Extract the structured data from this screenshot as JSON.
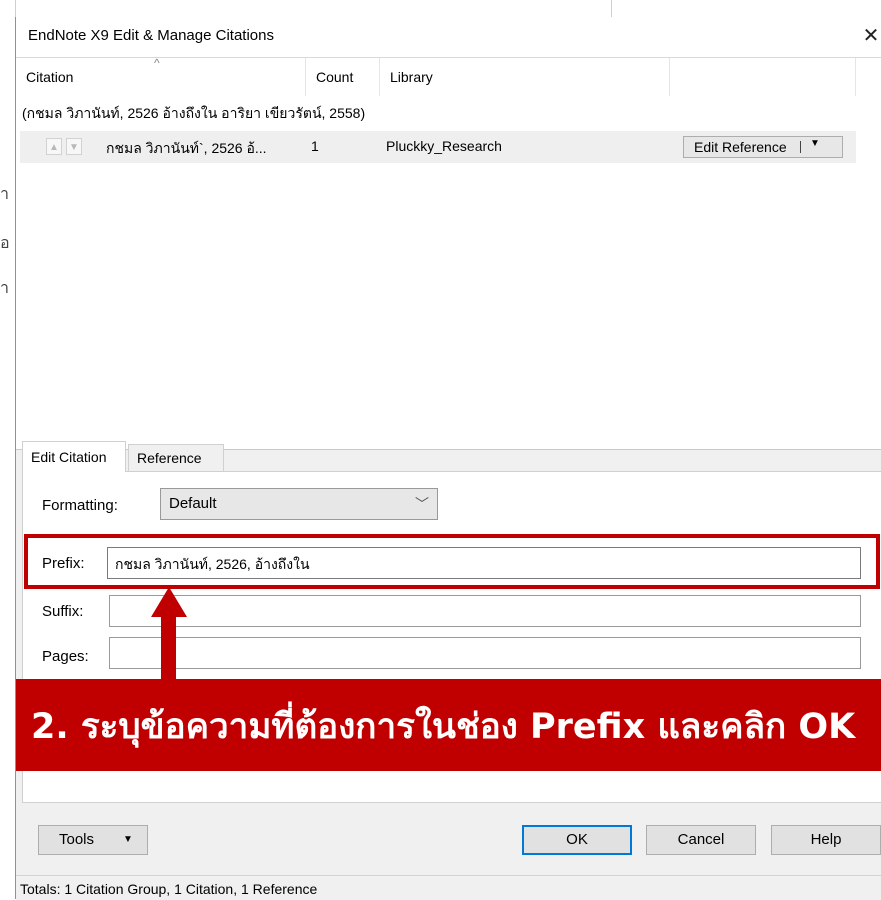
{
  "background_doc": {
    "fragments": [
      "า",
      "อ",
      "ำ"
    ]
  },
  "window": {
    "title": "EndNote X9 Edit & Manage Citations",
    "close_symbol": "✕"
  },
  "list": {
    "columns": [
      "Citation",
      "Count",
      "Library"
    ],
    "group_text": "(กชมล วิภานันท์, 2526 อ้างถึงใน อาริยา เขียวรัตน์, 2558)",
    "row": {
      "citation": "กชมล วิภานันท์`, 2526 อ้... ",
      "count": "1",
      "library": "Pluckky_Research",
      "edit_reference_label": "Edit Reference"
    }
  },
  "tabs": [
    {
      "label": "Edit Citation",
      "selected": true
    },
    {
      "label": "Reference",
      "selected": false
    }
  ],
  "edit_citation": {
    "formatting_label": "Formatting:",
    "formatting_value": "Default",
    "prefix_label": "Prefix:",
    "prefix_value": "กชมล วิภานันท์, 2526, อ้างถึงใน",
    "suffix_label": "Suffix:",
    "suffix_value": "",
    "pages_label": "Pages:",
    "pages_value": ""
  },
  "annotation": {
    "banner_text": "2. ระบุข้อความที่ต้องการในช่อง Prefix และคลิก OK",
    "highlight_color": "#c00000"
  },
  "buttons": {
    "tools": "Tools",
    "ok": "OK",
    "cancel": "Cancel",
    "help": "Help"
  },
  "status": {
    "totals": "Totals: 1 Citation Group, 1 Citation, 1 Reference"
  }
}
